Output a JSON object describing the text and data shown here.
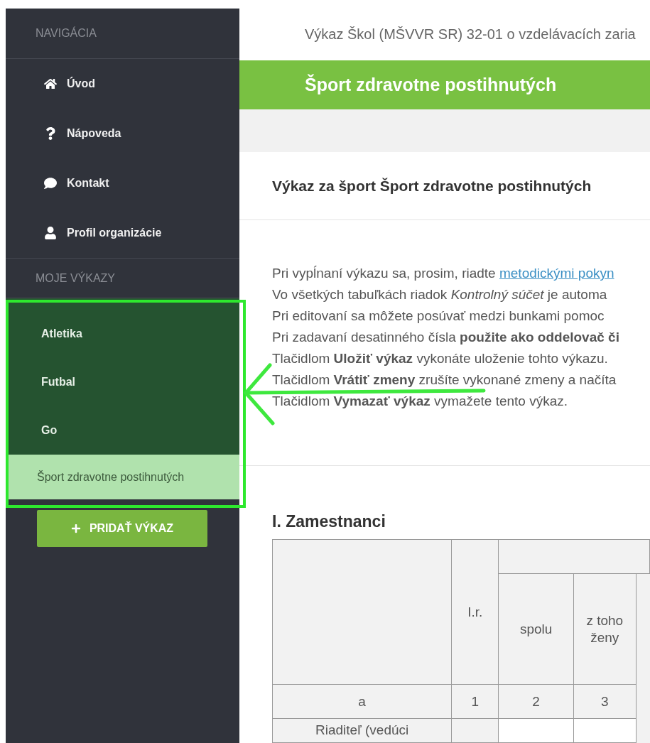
{
  "sidebar": {
    "sections": [
      {
        "heading": "NAVIGÁCIA",
        "items": [
          {
            "label": "Úvod",
            "selected": false
          },
          {
            "label": "Nápoveda",
            "selected": false
          },
          {
            "label": "Kontakt",
            "selected": false
          },
          {
            "label": "Profil organizácie",
            "selected": false
          }
        ]
      },
      {
        "heading": "MOJE VÝKAZY",
        "items": [
          {
            "label": "Atletika",
            "selected": false
          },
          {
            "label": "Futbal",
            "selected": false
          },
          {
            "label": "Go",
            "selected": false
          },
          {
            "label": "Šport zdravotne postihnutých",
            "selected": true
          }
        ]
      }
    ],
    "add_button": "PRIDAŤ VÝKAZ"
  },
  "breadcrumb": "Výkaz Škol (MŠVVR SR) 32-01 o vzdelávacích zaria",
  "page_title": "Šport zdravotne postihnutých",
  "card_title": "Výkaz za šport Šport zdravotne postihnutých",
  "instructions": [
    {
      "text": "Pri vypĺnaní výkazu sa, prosim, riadte ",
      "link": "metodickými pokyn"
    },
    {
      "text": "Vo všetkých tabuľkách riadok *Kontrolný súčet* je automa"
    },
    {
      "text": "Pri editovaní sa môžete posúvať medzi bunkami pomoc"
    },
    {
      "text": "Pri zadavaní desatinného čísla **použite ako oddelovač či**"
    },
    {
      "text": "Tlačidlom **Uložiť výkaz** vykonáte uloženie tohto výkazu."
    },
    {
      "text": "Tlačidlom **Vrátiť zmeny** zrušíte vykonané zmeny a načíta"
    },
    {
      "text": "Tlačidlom **Vymazať výkaz** vymažete tento výkaz."
    }
  ],
  "section_title": "I. Zamestnanci",
  "table": {
    "columns": [
      "",
      "I.r.",
      "spolu",
      "z toho ženy"
    ],
    "rows": [
      [
        "a",
        "1",
        "2",
        "3"
      ],
      [
        "Riaditeľ (vedúci",
        "",
        "",
        ""
      ]
    ]
  }
}
